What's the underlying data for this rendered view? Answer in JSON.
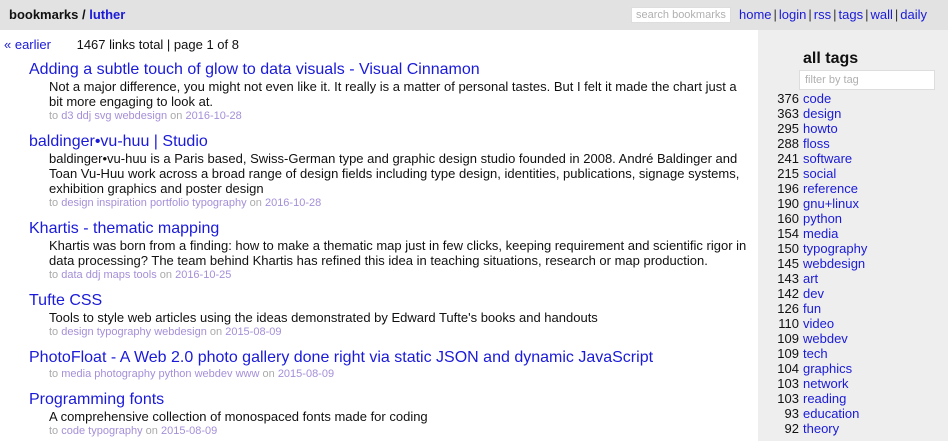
{
  "header": {
    "brand": "bookmarks",
    "separator": " / ",
    "user": "luther",
    "search_placeholder": "search bookmarks",
    "nav": [
      "home",
      "login",
      "rss",
      "tags",
      "wall",
      "daily"
    ]
  },
  "pager": {
    "earlier": "« earlier",
    "info": "1467 links total | page 1 of 8"
  },
  "entries": [
    {
      "title": "Adding a subtle touch of glow to data visuals - Visual Cinnamon",
      "description": "Not a major difference, you might not even like it. It really is a matter of personal tastes. But I felt it made the chart just a bit more engaging to look at.",
      "to": "to",
      "tags": [
        "d3",
        "ddj",
        "svg",
        "webdesign"
      ],
      "on": "on",
      "date": "2016-10-28"
    },
    {
      "title": "baldinger•vu-huu | Studio",
      "description": "baldinger•vu-huu is a Paris based, Swiss-German type and graphic design studio founded in 2008. André Baldinger and Toan Vu-Huu work across a broad range of design fields including type design, identities, publications, signage systems, exhibition graphics and poster design",
      "to": "to",
      "tags": [
        "design",
        "inspiration",
        "portfolio",
        "typography"
      ],
      "on": "on",
      "date": "2016-10-28"
    },
    {
      "title": "Khartis - thematic mapping",
      "description": "Khartis was born from a finding: how to make a thematic map just in few clicks, keeping requirement and scientific rigor in data processing? The team behind Khartis has refined this idea in teaching situations, research or map production.",
      "to": "to",
      "tags": [
        "data",
        "ddj",
        "maps",
        "tools"
      ],
      "on": "on",
      "date": "2016-10-25"
    },
    {
      "title": "Tufte CSS",
      "description": "Tools to style web articles using the ideas demonstrated by Edward Tufte's books and handouts",
      "to": "to",
      "tags": [
        "design",
        "typography",
        "webdesign"
      ],
      "on": "on",
      "date": "2015-08-09"
    },
    {
      "title": "PhotoFloat - A Web 2.0 photo gallery done right via static JSON and dynamic JavaScript",
      "description": "",
      "to": "to",
      "tags": [
        "media",
        "photography",
        "python",
        "webdev",
        "www"
      ],
      "on": "on",
      "date": "2015-08-09"
    },
    {
      "title": "Programming fonts",
      "description": "A comprehensive collection of monospaced fonts made for coding",
      "to": "to",
      "tags": [
        "code",
        "typography"
      ],
      "on": "on",
      "date": "2015-08-09"
    }
  ],
  "sidebar": {
    "title": "all tags",
    "filter_placeholder": "filter by tag",
    "tags": [
      {
        "count": "376",
        "name": "code"
      },
      {
        "count": "363",
        "name": "design"
      },
      {
        "count": "295",
        "name": "howto"
      },
      {
        "count": "288",
        "name": "floss"
      },
      {
        "count": "241",
        "name": "software"
      },
      {
        "count": "215",
        "name": "social"
      },
      {
        "count": "196",
        "name": "reference"
      },
      {
        "count": "190",
        "name": "gnu+linux"
      },
      {
        "count": "160",
        "name": "python"
      },
      {
        "count": "154",
        "name": "media"
      },
      {
        "count": "150",
        "name": "typography"
      },
      {
        "count": "145",
        "name": "webdesign"
      },
      {
        "count": "143",
        "name": "art"
      },
      {
        "count": "142",
        "name": "dev"
      },
      {
        "count": "126",
        "name": "fun"
      },
      {
        "count": "110",
        "name": "video"
      },
      {
        "count": "109",
        "name": "webdev"
      },
      {
        "count": "109",
        "name": "tech"
      },
      {
        "count": "104",
        "name": "graphics"
      },
      {
        "count": "103",
        "name": "network"
      },
      {
        "count": "103",
        "name": "reading"
      },
      {
        "count": "93",
        "name": "education"
      },
      {
        "count": "92",
        "name": "theory"
      }
    ]
  },
  "colors": {
    "link": "#1a1ad8",
    "meta_link": "#a58fd8",
    "topbar_bg": "#e2e2e2",
    "sidebar_bg": "#eeeeee"
  }
}
